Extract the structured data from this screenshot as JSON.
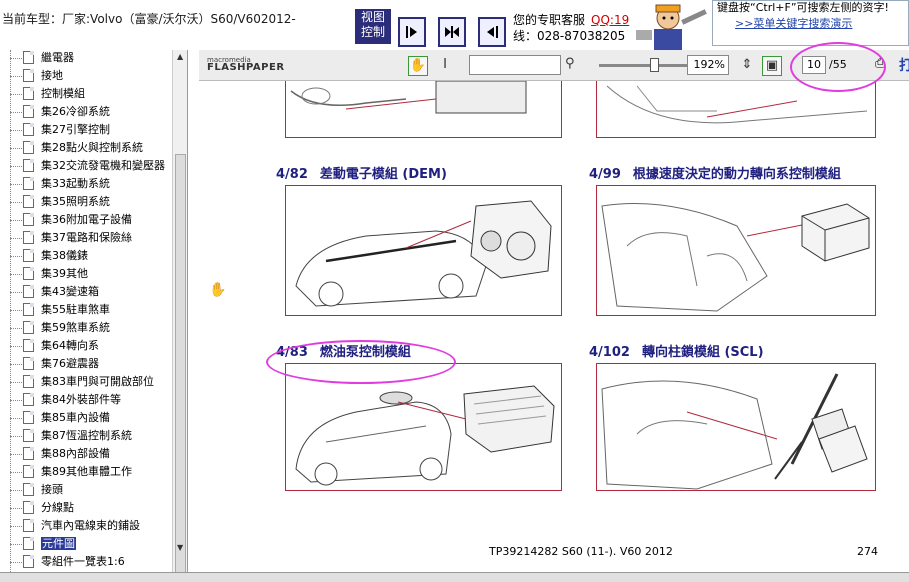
{
  "header": {
    "car_line": "当前车型：厂家:Volvo（富豪/沃尔沃）S60/V602012-",
    "view_control": [
      "视图",
      "控制"
    ],
    "service_label": "您的专职客服",
    "qq_label": "QQ:19",
    "phone_line": "线：028-87038205",
    "tip_text": "键盘按“Ctrl+F”可搜索左侧的资字!",
    "tip_link": ">>菜单关键字搜索演示"
  },
  "tree": {
    "items": [
      "繼電器",
      "接地",
      "控制模組",
      "集26冷卻系統",
      "集27引擎控制",
      "集28點火與控制系統",
      "集32交流發電機和變壓器",
      "集33起動系統",
      "集35照明系統",
      "集36附加電子設備",
      "集37電路和保險絲",
      "集38儀錶",
      "集39其他",
      "集43變速箱",
      "集55駐車煞車",
      "集59煞車系統",
      "集64轉向系",
      "集76避震器",
      "集83車門與可開啟部位",
      "集84外裝部件等",
      "集85車內設備",
      "集87恆溫控制系統",
      "集88內部設備",
      "集89其他車體工作",
      "接頭",
      "分線點",
      "汽車內電線束的鋪設",
      "元件圖",
      "零組件一覽表1:6"
    ],
    "selected_index": 27
  },
  "toolbar": {
    "logo_top": "macromedia",
    "logo_bottom": "FLASHPAPER",
    "zoom": "192%",
    "page_current": "10",
    "page_total": "/55",
    "print_label": "打"
  },
  "document": {
    "sections": [
      {
        "num": "4/82",
        "title": "差動電子模組 (DEM)"
      },
      {
        "num": "4/99",
        "title": "根據速度決定的動力轉向系控制模組"
      },
      {
        "num": "4/83",
        "title": "燃油泵控制模組"
      },
      {
        "num": "4/102",
        "title": "轉向柱鎖模組 (SCL)"
      }
    ],
    "footer_doc": "TP39214282 S60 (11-). V60 2012",
    "footer_page": "274"
  },
  "colors": {
    "heading": "#202080",
    "panel_border": "#b02a3c",
    "annotation": "#e03ce0",
    "highlight_box": "#e82020",
    "selection": "#2b3a9a"
  }
}
